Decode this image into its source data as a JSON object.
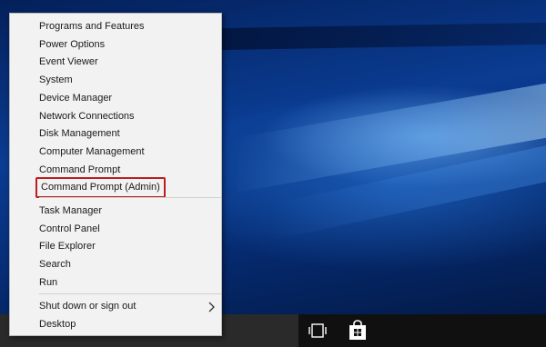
{
  "menu": {
    "group1": [
      "Programs and Features",
      "Power Options",
      "Event Viewer",
      "System",
      "Device Manager",
      "Network Connections",
      "Disk Management",
      "Computer Management",
      "Command Prompt",
      "Command Prompt (Admin)"
    ],
    "group2": [
      "Task Manager",
      "Control Panel",
      "File Explorer",
      "Search",
      "Run"
    ],
    "group3": [
      "Shut down or sign out",
      "Desktop"
    ],
    "highlight_color": "#b81f1f"
  },
  "taskbar": {
    "icons": [
      "task-view-icon",
      "store-icon"
    ]
  }
}
